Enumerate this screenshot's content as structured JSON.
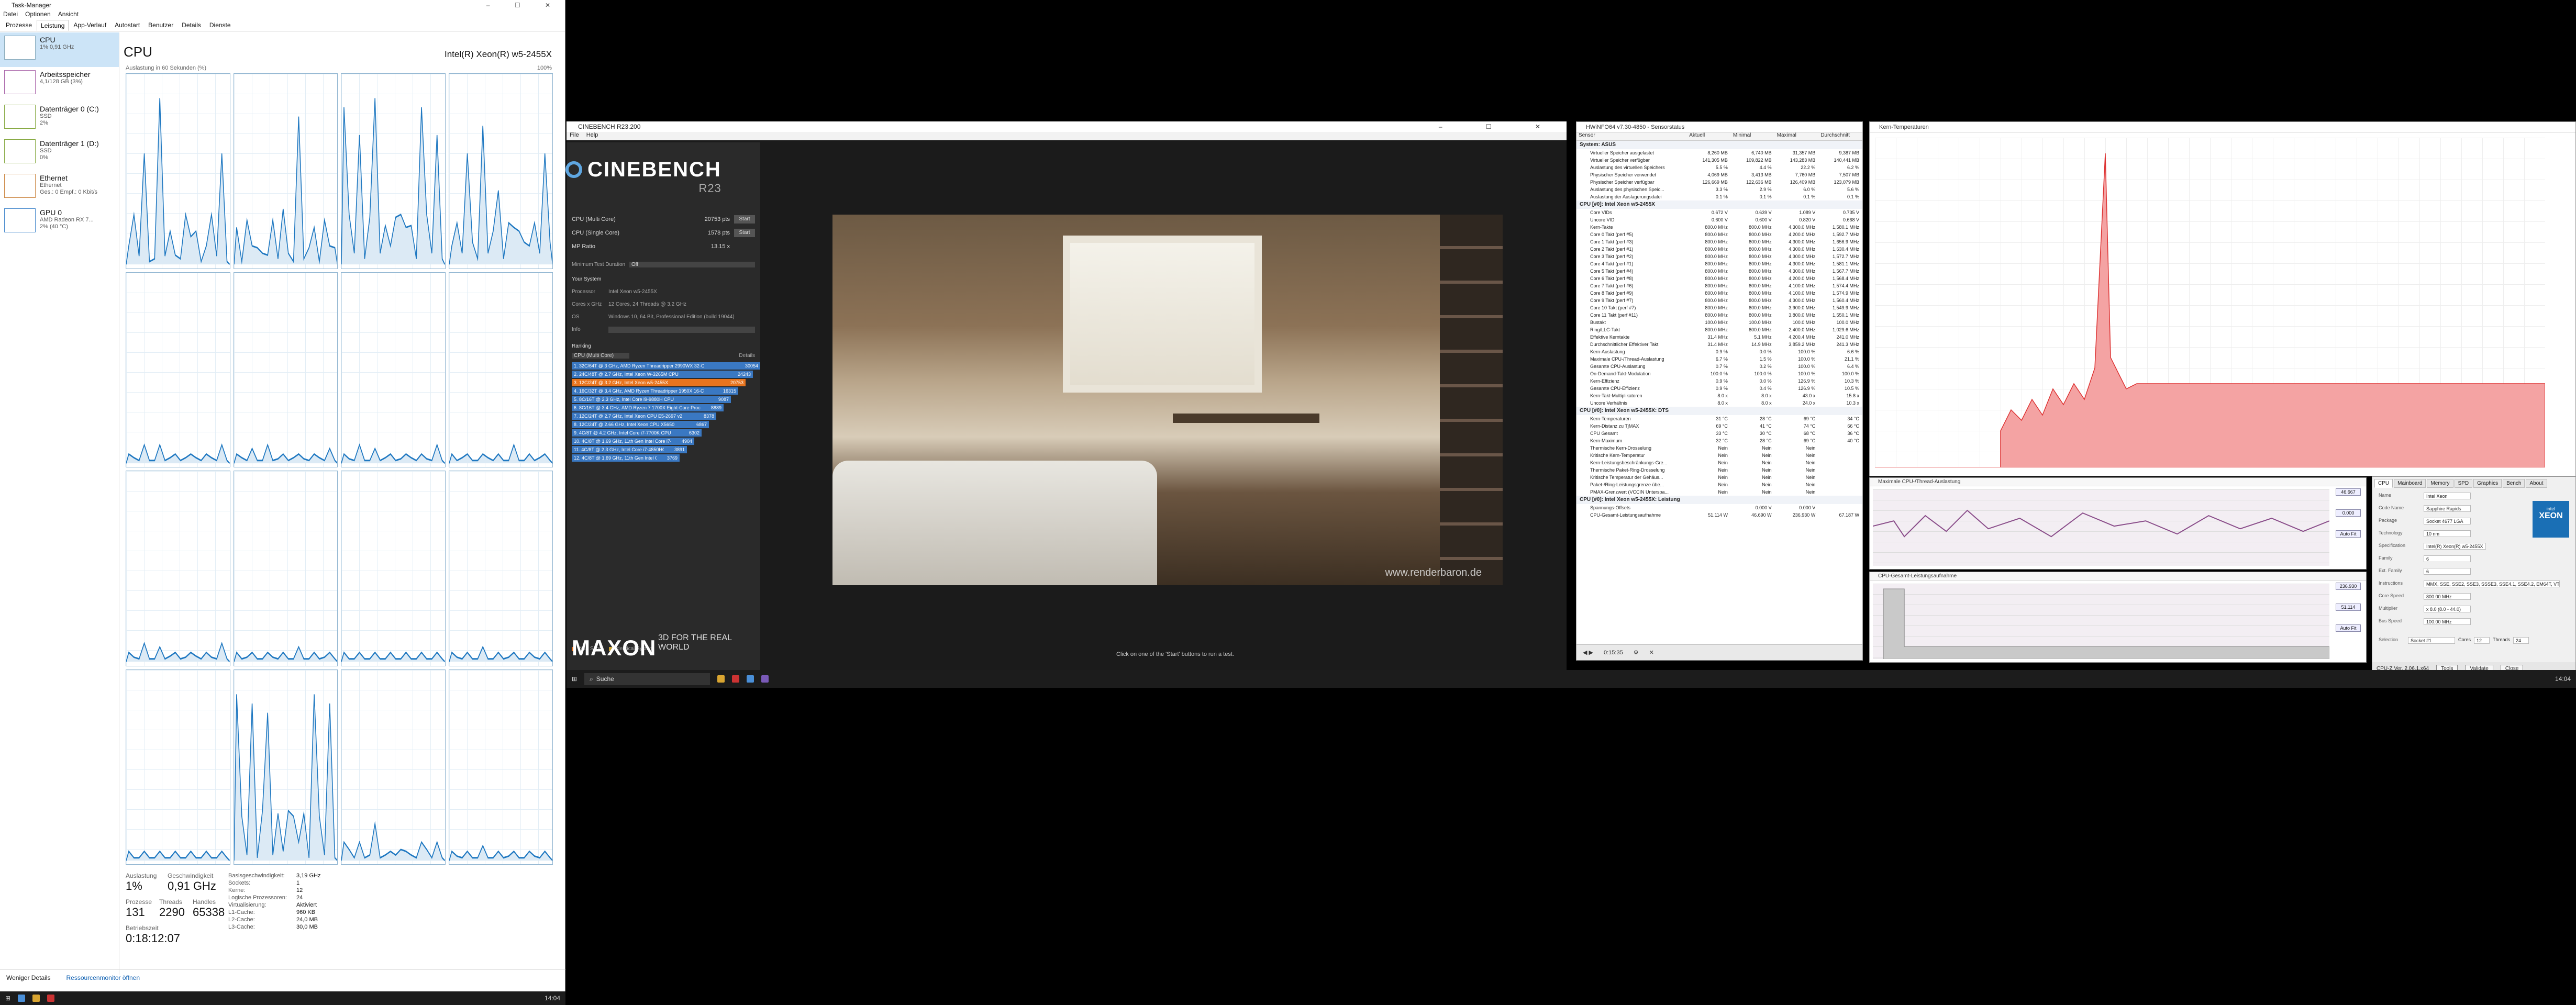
{
  "taskmanager": {
    "title": "Task-Manager",
    "menu": [
      "Datei",
      "Optionen",
      "Ansicht"
    ],
    "tabs": [
      "Prozesse",
      "Leistung",
      "App-Verlauf",
      "Autostart",
      "Benutzer",
      "Details",
      "Dienste"
    ],
    "resources": [
      {
        "title": "CPU",
        "sub": "1% 0,91 GHz"
      },
      {
        "title": "Arbeitsspeicher",
        "sub": "4,1/128 GB (3%)"
      },
      {
        "title": "Datenträger 0 (C:)",
        "sub": "SSD",
        "sub2": "2%"
      },
      {
        "title": "Datenträger 1 (D:)",
        "sub": "SSD",
        "sub2": "0%"
      },
      {
        "title": "Ethernet",
        "sub": "Ethernet",
        "sub2": "Ges.: 0 Empf.: 0 Kbit/s"
      },
      {
        "title": "GPU 0",
        "sub": "AMD Radeon RX 7...",
        "sub2": "2% (40 °C)"
      }
    ],
    "cpu_title": "CPU",
    "cpu_model": "Intel(R) Xeon(R) w5-2455X",
    "graph_caption": "Auslastung in 60 Sekunden (%)",
    "graph_max": "100%",
    "stats": {
      "auslastung_label": "Auslastung",
      "auslastung": "1%",
      "geschw_label": "Geschwindigkeit",
      "geschw": "0,91 GHz",
      "prozesse_label": "Prozesse",
      "prozesse": "131",
      "threads_label": "Threads",
      "threads": "2290",
      "handles_label": "Handles",
      "handles": "65338",
      "betrieb_label": "Betriebszeit",
      "betrieb": "0:18:12:07"
    },
    "kv": [
      [
        "Basisgeschwindigkeit:",
        "3,19 GHz"
      ],
      [
        "Sockets:",
        "1"
      ],
      [
        "Kerne:",
        "12"
      ],
      [
        "Logische Prozessoren:",
        "24"
      ],
      [
        "Virtualisierung:",
        "Aktiviert"
      ],
      [
        "L1-Cache:",
        "960 KB"
      ],
      [
        "L2-Cache:",
        "24,0 MB"
      ],
      [
        "L3-Cache:",
        "30,0 MB"
      ]
    ],
    "bottom_less": "Weniger Details",
    "bottom_monitor": "Ressourcenmonitor öffnen",
    "clock": "14:04"
  },
  "cinebench": {
    "title": "CINEBENCH R23.200",
    "menu": [
      "File",
      "Help"
    ],
    "logo": "CINEBENCH",
    "version": "R23",
    "rows": [
      {
        "label": "CPU (Multi Core)",
        "value": "20753 pts",
        "btn": "Start"
      },
      {
        "label": "CPU (Single Core)",
        "value": "1578 pts",
        "btn": "Start"
      },
      {
        "label": "MP Ratio",
        "value": "13.15 x",
        "btn": ""
      }
    ],
    "min_duration_label": "Minimum Test Duration",
    "min_duration": "Off",
    "your_system": "Your System",
    "info": [
      [
        "Processor",
        "Intel Xeon w5-2455X"
      ],
      [
        "Cores x GHz",
        "12 Cores, 24 Threads @ 3.2 GHz"
      ],
      [
        "OS",
        "Windows 10, 64 Bit, Professional Edition (build 19044)"
      ],
      [
        "Info",
        ""
      ]
    ],
    "ranking_label": "Ranking",
    "ranking_select": "CPU (Multi Core)",
    "details_label": "Details",
    "ranking": [
      {
        "name": "1. 32C/64T @ 3 GHz, AMD Ryzen Threadripper 2990WX 32-C",
        "value": "30054",
        "color": "#3a78c2"
      },
      {
        "name": "2. 24C/48T @ 2.7 GHz, Intel Xeon W-3265M CPU",
        "value": "24243",
        "color": "#3a78c2"
      },
      {
        "name": "3. 12C/24T @ 3.2 GHz, Intel Xeon w5-2455X",
        "value": "20753",
        "color": "#e8741e"
      },
      {
        "name": "4. 16C/32T @ 3.4 GHz, AMD Ryzen Threadripper 1950X 16-C",
        "value": "16315",
        "color": "#3a78c2"
      },
      {
        "name": "5. 8C/16T @ 2.3 GHz, Intel Core i9-9880H CPU",
        "value": "9087",
        "color": "#3a78c2"
      },
      {
        "name": "6. 8C/16T @ 3.4 GHz, AMD Ryzen 7 1700X Eight-Core Processo",
        "value": "8889",
        "color": "#3a78c2"
      },
      {
        "name": "7. 12C/24T @ 2.7 GHz, Intel Xeon CPU E5-2697 v2",
        "value": "8378",
        "color": "#3a78c2"
      },
      {
        "name": "8. 12C/24T @ 2.66 GHz, Intel Xeon CPU X5650",
        "value": "6867",
        "color": "#3a78c2"
      },
      {
        "name": "9. 4C/8T @ 4.2 GHz, Intel Core i7-7700K CPU",
        "value": "6302",
        "color": "#3a78c2"
      },
      {
        "name": "10. 4C/8T @ 1.69 GHz, 11th Gen Intel Core i7-1165G7 @15W",
        "value": "4904",
        "color": "#3a78c2"
      },
      {
        "name": "11. 4C/8T @ 2.3 GHz, Intel Core i7-4850HQ CPU",
        "value": "3891",
        "color": "#3a78c2"
      },
      {
        "name": "12. 4C/8T @ 1.69 GHz, 11th Gen Intel Core i7-1165G7 @15W",
        "value": "3769",
        "color": "#3a78c2"
      }
    ],
    "legend_your": "Your Score",
    "legend_identical": "Identical System",
    "maxon": "MAXON",
    "maxon_tag": "3D FOR THE REAL WORLD",
    "watermark": "www.renderbaron.de",
    "hint": "Click on one of the 'Start' buttons to run a test."
  },
  "hwinfo": {
    "title": "HWiNFO64 v7.30-4850 - Sensorstatus",
    "headers": [
      "Sensor",
      "Aktuell",
      "Minimal",
      "Maximal",
      "Durchschnitt"
    ],
    "groups": [
      {
        "name": "System: ASUS",
        "rows": [
          [
            "Virtueller Speicher ausgelastet",
            "8,260 MB",
            "6,740 MB",
            "31,357 MB",
            "9,387 MB"
          ],
          [
            "Virtueller Speicher verfügbar",
            "141,305 MB",
            "109,822 MB",
            "143,283 MB",
            "140,441 MB"
          ],
          [
            "Auslastung des virtuellen Speichers",
            "5.5 %",
            "4.4 %",
            "22.2 %",
            "6.2 %"
          ],
          [
            "Physischer Speicher verwendet",
            "4,069 MB",
            "3,413 MB",
            "7,760 MB",
            "7,507 MB"
          ],
          [
            "Physischer Speicher verfügbar",
            "126,669 MB",
            "122,636 MB",
            "126,409 MB",
            "123,079 MB"
          ],
          [
            "Auslastung des physischen Speic...",
            "3.3 %",
            "2.9 %",
            "6.0 %",
            "5.6 %"
          ],
          [
            "Auslastung der Auslagerungsdatei",
            "0.1 %",
            "0.1 %",
            "0.1 %",
            "0.1 %"
          ]
        ]
      },
      {
        "name": "CPU [#0]: Intel Xeon w5-2455X",
        "rows": [
          [
            "Core VIDs",
            "0.672 V",
            "0.639 V",
            "1.089 V",
            "0.735 V"
          ],
          [
            "Uncore VID",
            "0.600 V",
            "0.600 V",
            "0.820 V",
            "0.668 V"
          ],
          [
            "Kern-Takte",
            "800.0 MHz",
            "800.0 MHz",
            "4,300.0 MHz",
            "1,580.1 MHz"
          ],
          [
            "Core 0 Takt (perf #5)",
            "800.0 MHz",
            "800.0 MHz",
            "4,200.0 MHz",
            "1,592.7 MHz"
          ],
          [
            "Core 1 Takt (perf #3)",
            "800.0 MHz",
            "800.0 MHz",
            "4,300.0 MHz",
            "1,656.9 MHz"
          ],
          [
            "Core 2 Takt (perf #1)",
            "800.0 MHz",
            "800.0 MHz",
            "4,300.0 MHz",
            "1,630.4 MHz"
          ],
          [
            "Core 3 Takt (perf #2)",
            "800.0 MHz",
            "800.0 MHz",
            "4,300.0 MHz",
            "1,572.7 MHz"
          ],
          [
            "Core 4 Takt (perf #1)",
            "800.0 MHz",
            "800.0 MHz",
            "4,300.0 MHz",
            "1,581.1 MHz"
          ],
          [
            "Core 5 Takt (perf #4)",
            "800.0 MHz",
            "800.0 MHz",
            "4,300.0 MHz",
            "1,567.7 MHz"
          ],
          [
            "Core 6 Takt (perf #8)",
            "800.0 MHz",
            "800.0 MHz",
            "4,200.0 MHz",
            "1,568.4 MHz"
          ],
          [
            "Core 7 Takt (perf #6)",
            "800.0 MHz",
            "800.0 MHz",
            "4,100.0 MHz",
            "1,574.4 MHz"
          ],
          [
            "Core 8 Takt (perf #9)",
            "800.0 MHz",
            "800.0 MHz",
            "4,100.0 MHz",
            "1,574.9 MHz"
          ],
          [
            "Core 9 Takt (perf #7)",
            "800.0 MHz",
            "800.0 MHz",
            "4,300.0 MHz",
            "1,560.4 MHz"
          ],
          [
            "Core 10 Takt (perf #7)",
            "800.0 MHz",
            "800.0 MHz",
            "3,900.0 MHz",
            "1,549.9 MHz"
          ],
          [
            "Core 11 Takt (perf #11)",
            "800.0 MHz",
            "800.0 MHz",
            "3,800.0 MHz",
            "1,550.1 MHz"
          ],
          [
            "Bustakt",
            "100.0 MHz",
            "100.0 MHz",
            "100.0 MHz",
            "100.0 MHz"
          ],
          [
            "Ring/LLC-Takt",
            "800.0 MHz",
            "800.0 MHz",
            "2,400.0 MHz",
            "1,029.6 MHz"
          ],
          [
            "Effektive Kerntakte",
            "31.4 MHz",
            "5.1 MHz",
            "4,200.4 MHz",
            "241.0 MHz"
          ],
          [
            "Durchschnittlicher Effektiver Takt",
            "31.4 MHz",
            "14.9 MHz",
            "3,859.2 MHz",
            "241.3 MHz"
          ],
          [
            "Kern-Auslastung",
            "0.9 %",
            "0.0 %",
            "100.0 %",
            "6.6 %"
          ],
          [
            "Maximale CPU-/Thread-Auslastung",
            "6.7 %",
            "1.5 %",
            "100.0 %",
            "21.1 %"
          ],
          [
            "Gesamte CPU-Auslastung",
            "0.7 %",
            "0.2 %",
            "100.0 %",
            "6.4 %"
          ],
          [
            "On-Demand-Takt-Modulation",
            "100.0 %",
            "100.0 %",
            "100.0 %",
            "100.0 %"
          ],
          [
            "Kern-Effizienz",
            "0.9 %",
            "0.0 %",
            "126.9 %",
            "10.3 %"
          ],
          [
            "Gesamte CPU-Effizienz",
            "0.9 %",
            "0.4 %",
            "126.9 %",
            "10.5 %"
          ],
          [
            "Kern-Takt-Multiplikatoren",
            "8.0 x",
            "8.0 x",
            "43.0 x",
            "15.8 x"
          ],
          [
            "Uncore Verhältnis",
            "8.0 x",
            "8.0 x",
            "24.0 x",
            "10.3 x"
          ]
        ]
      },
      {
        "name": "CPU [#0]: Intel Xeon w5-2455X: DTS",
        "rows": [
          [
            "Kern-Temperaturen",
            "31 °C",
            "28 °C",
            "69 °C",
            "34 °C"
          ],
          [
            "Kern-Distanz zu TjMAX",
            "69 °C",
            "41 °C",
            "74 °C",
            "66 °C"
          ],
          [
            "CPU Gesamt",
            "33 °C",
            "30 °C",
            "68 °C",
            "36 °C"
          ],
          [
            "Kern-Maximum",
            "32 °C",
            "28 °C",
            "69 °C",
            "40 °C"
          ],
          [
            "Thermische Kern-Drosselung",
            "Nein",
            "Nein",
            "Nein",
            ""
          ],
          [
            "Kritische Kern-Temperatur",
            "Nein",
            "Nein",
            "Nein",
            ""
          ],
          [
            "Kern-Leistungsbeschränkungs-Gre...",
            "Nein",
            "Nein",
            "Nein",
            ""
          ],
          [
            "Thermische Paket-Ring-Drosselung",
            "Nein",
            "Nein",
            "Nein",
            ""
          ],
          [
            "Kritische Temperatur der Gehäus...",
            "Nein",
            "Nein",
            "Nein",
            ""
          ],
          [
            "Paket-/Ring-Leistungsgrenze übe...",
            "Nein",
            "Nein",
            "Nein",
            ""
          ],
          [
            "PMAX-Grenzwert (VCCIN Unterspa...",
            "Nein",
            "Nein",
            "Nein",
            ""
          ]
        ]
      },
      {
        "name": "CPU [#0]: Intel Xeon w5-2455X: Leistung",
        "rows": [
          [
            "Spannungs-Offsets",
            "",
            "0.000 V",
            "0.000 V",
            ""
          ],
          [
            "CPU-Gesamt-Leistungsaufnahme",
            "51.114 W",
            "46.690 W",
            "236.930 W",
            "67.187 W"
          ]
        ]
      }
    ],
    "footer_time": "0:15:35"
  },
  "temp_graph": {
    "title": "Kern-Temperaturen"
  },
  "gpu_graph": {
    "title": "Maximale CPU-/Thread-Auslastung",
    "v1": "46.667",
    "v2": "0.000",
    "btn": "Auto Fit"
  },
  "power_graph": {
    "title": "CPU-Gesamt-Leistungsaufnahme",
    "v1": "236.930",
    "v2": "51.114",
    "btn": "Auto Fit"
  },
  "cpuz": {
    "tabs": [
      "CPU",
      "Mainboard",
      "Memory",
      "SPD",
      "Graphics",
      "Bench",
      "About"
    ],
    "fields": [
      [
        "Name",
        "Intel Xeon"
      ],
      [
        "Code Name",
        "Sapphire Rapids"
      ],
      [
        "Package",
        "Socket 4677 LGA"
      ],
      [
        "Technology",
        "10 nm"
      ],
      [
        "Specification",
        "Intel(R) Xeon(R) w5-2455X"
      ],
      [
        "Family",
        "6"
      ],
      [
        "Ext. Family",
        "6"
      ],
      [
        "Instructions",
        "MMX, SSE, SSE2, SSE3, SSSE3, SSE4.1, SSE4.2, EM64T, VT-x, AES, AVX, AVX2, AVX512F, FMA3, SHA"
      ],
      [
        "Core Speed",
        "800.00 MHz"
      ],
      [
        "Multiplier",
        "x 8.0 (8.0 - 44.0)"
      ],
      [
        "Bus Speed",
        "100.00 MHz"
      ]
    ],
    "logo": "XEON",
    "logo_sub": "intel",
    "selection_label": "Selection",
    "selection": "Socket #1",
    "cores_label": "Cores",
    "cores": "12",
    "threads_label": "Threads",
    "threads": "24",
    "version": "CPU-Z  Ver. 2.06.1.x64",
    "tools": "Tools",
    "validate": "Validate",
    "close": "Close"
  },
  "taskbar": {
    "search": "Suche",
    "clock": "14:04"
  }
}
